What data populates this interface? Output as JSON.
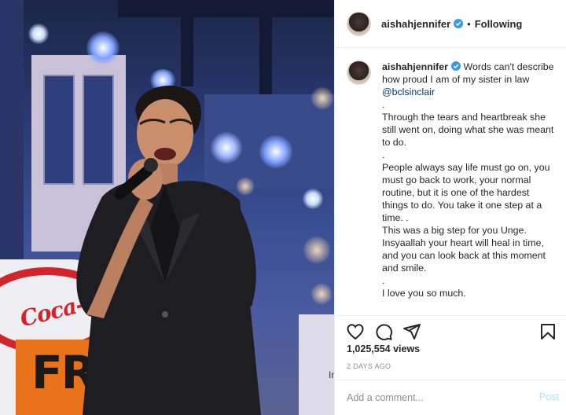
{
  "post": {
    "username": "aishahjennifer",
    "follow_status": "Following",
    "separator": "•",
    "caption_lines": [
      "Words can't describe how proud I am of my sister in law",
      "@bclsinclair",
      ".",
      "Through the tears and heartbreak she still went on, doing what she was meant to do.",
      ".",
      "People always say life must go on, you must go back to work, your normal routine, but it is one of the hardest things to do. You take it one step at a time. .",
      "This was a big step for you Unge. Insyaallah your heart will heal in time, and you can look back at this moment and smile.",
      ".",
      "I love you so much."
    ],
    "views": "1,025,554 views",
    "time_ago": "2 DAYS AGO"
  },
  "media": {
    "brand_script": "Coca-Cola",
    "sign_text": "FR",
    "sign_side_text": "In"
  },
  "comment": {
    "placeholder": "Add a comment...",
    "post_label": "Post"
  },
  "icons": {
    "verified": "verified-badge-icon",
    "more": "more-options-icon",
    "like": "heart-icon",
    "comment": "comment-bubble-icon",
    "share": "paper-plane-icon",
    "save": "bookmark-icon"
  },
  "colors": {
    "verified_blue": "#3897f0",
    "mention": "#00376b",
    "muted": "#8e8e8e",
    "post_disabled": "#b2dffc"
  }
}
